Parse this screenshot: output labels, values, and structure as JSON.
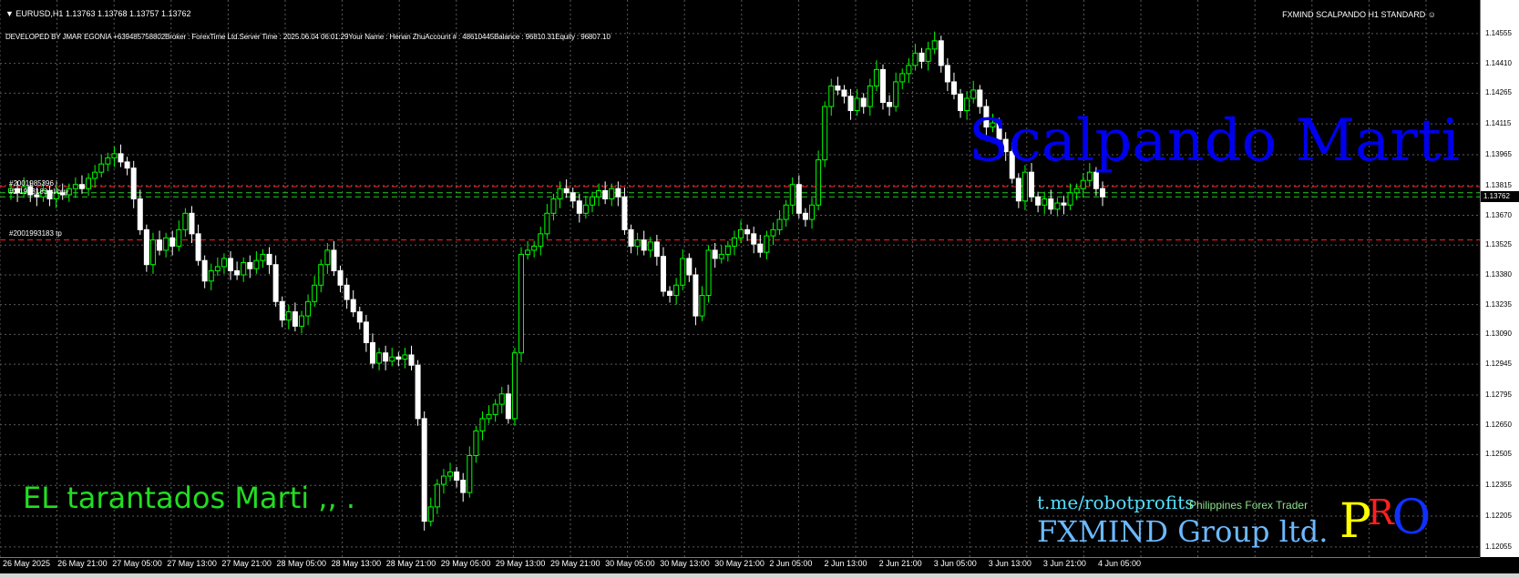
{
  "header": {
    "symbol_line": "▼ EURUSD,H1  1.13763 1.13768 1.13757 1.13762",
    "info_line": "DEVELOPED BY JMAR EGONIA  +639485758802Broker  : ForexTime Ltd.Server Time : 2025.06.04 06:01:29Your Name   : Henan ZhuAccount #   : 48610445Balance : 96810.31Equity    : 96807.10",
    "ea_name": "FXMIND SCALPANDO H1 STANDARD ☺"
  },
  "overlay": {
    "brand": "Scalpando Marti",
    "tarantados": "EL tarantados Marti   ,, .",
    "telegram": "t.me/robotprofits",
    "philippines": "Philippines Forex Trader",
    "group": "FXMIND Group ltd.",
    "pro_p": "P",
    "pro_r": "R",
    "pro_o": "O"
  },
  "orders": {
    "top1": "#2001985396 l",
    "top2": "#2 1993183 sl/buy",
    "tp": "#2001993183 tp"
  },
  "colors": {
    "background": "#000000",
    "grid": "#5a5a5a",
    "bull": "#00ff00",
    "bear": "#ffffff",
    "sl_line": "#ff2020",
    "entry_line": "#22cc22"
  },
  "chart_data": {
    "type": "candlestick",
    "symbol": "EURUSD",
    "timeframe": "H1",
    "ylim": [
      1.1205,
      1.1463
    ],
    "y_ticks": [
      "1.14555",
      "1.14410",
      "1.14265",
      "1.14115",
      "1.13965",
      "1.13815",
      "1.13670",
      "1.13525",
      "1.13380",
      "1.13235",
      "1.13090",
      "1.12945",
      "1.12795",
      "1.12650",
      "1.12505",
      "1.12355",
      "1.12205",
      "1.12055"
    ],
    "x_labels": [
      "26 May 2025",
      "26 May 21:00",
      "27 May 05:00",
      "27 May 13:00",
      "27 May 21:00",
      "28 May 05:00",
      "28 May 13:00",
      "28 May 21:00",
      "29 May 05:00",
      "29 May 13:00",
      "29 May 21:00",
      "30 May 05:00",
      "30 May 13:00",
      "30 May 21:00",
      "2 Jun 05:00",
      "2 Jun 13:00",
      "2 Jun 21:00",
      "3 Jun 05:00",
      "3 Jun 13:00",
      "3 Jun 21:00",
      "4 Jun 05:00"
    ],
    "current_price": "1.13762",
    "lines": {
      "sl_upper": 1.1381,
      "entry_a": 1.1378,
      "entry_b": 1.1376,
      "tp": 1.1355
    },
    "closes": [
      1.138,
      1.1378,
      1.1381,
      1.1377,
      1.1376,
      1.1379,
      1.1375,
      1.1378,
      1.1377,
      1.138,
      1.1382,
      1.138,
      1.1385,
      1.1388,
      1.1392,
      1.1395,
      1.1397,
      1.1393,
      1.139,
      1.1375,
      1.136,
      1.1343,
      1.1355,
      1.135,
      1.1356,
      1.1352,
      1.136,
      1.1368,
      1.1358,
      1.1345,
      1.1335,
      1.134,
      1.1342,
      1.1346,
      1.134,
      1.1338,
      1.1344,
      1.1341,
      1.1345,
      1.1348,
      1.1343,
      1.1325,
      1.1316,
      1.132,
      1.1313,
      1.1318,
      1.1325,
      1.1333,
      1.1343,
      1.135,
      1.134,
      1.1333,
      1.1326,
      1.132,
      1.1315,
      1.1305,
      1.1295,
      1.13,
      1.1296,
      1.1298,
      1.1297,
      1.1299,
      1.1294,
      1.1268,
      1.1218,
      1.1225,
      1.1236,
      1.124,
      1.1242,
      1.1238,
      1.1232,
      1.125,
      1.1262,
      1.1268,
      1.127,
      1.1275,
      1.128,
      1.1268,
      1.13,
      1.1348,
      1.135,
      1.1352,
      1.1358,
      1.1368,
      1.1375,
      1.138,
      1.1378,
      1.1374,
      1.1368,
      1.1372,
      1.1376,
      1.1379,
      1.1375,
      1.138,
      1.1376,
      1.136,
      1.1352,
      1.1355,
      1.135,
      1.1354,
      1.1347,
      1.133,
      1.1328,
      1.1333,
      1.1346,
      1.1338,
      1.1318,
      1.1328,
      1.135,
      1.1346,
      1.1348,
      1.1352,
      1.1356,
      1.136,
      1.1358,
      1.1353,
      1.1349,
      1.1357,
      1.136,
      1.1365,
      1.1372,
      1.1382,
      1.1368,
      1.1365,
      1.1372,
      1.1394,
      1.142,
      1.143,
      1.1428,
      1.1425,
      1.1418,
      1.1424,
      1.142,
      1.143,
      1.1438,
      1.1422,
      1.142,
      1.1432,
      1.1436,
      1.144,
      1.1446,
      1.1442,
      1.1448,
      1.1452,
      1.144,
      1.1432,
      1.1426,
      1.1418,
      1.1424,
      1.1428,
      1.142,
      1.141,
      1.1412,
      1.1404,
      1.1398,
      1.1385,
      1.1374,
      1.1388,
      1.1376,
      1.1372,
      1.1375,
      1.137,
      1.1373,
      1.1372,
      1.1378,
      1.138,
      1.1384,
      1.1388,
      1.138,
      1.1376
    ]
  }
}
